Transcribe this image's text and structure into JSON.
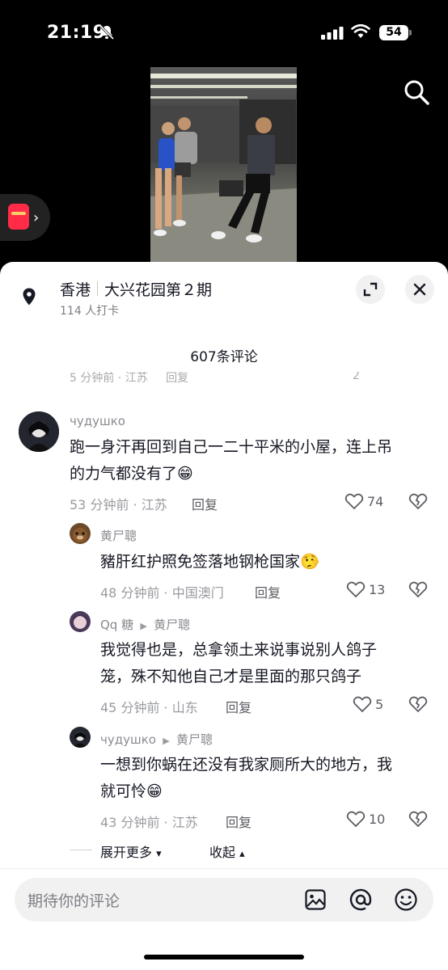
{
  "status_bar": {
    "time": "21:19",
    "battery": "54"
  },
  "location": {
    "city": "香港",
    "place": "大兴花园第２期",
    "checkins": "114 人打卡"
  },
  "comments_count": "607条评论",
  "cut_row": {
    "meta": "5 分钟前 · 江苏",
    "reply": "回复",
    "likes": "2"
  },
  "comments": [
    {
      "user": "чудушко",
      "text_line1": "跑一身汗再回到自己一二十平米的小屋，连上吊",
      "text_line2": "的力气都没有了😁",
      "meta": "53 分钟前 · 江苏",
      "reply": "回复",
      "likes": "74"
    }
  ],
  "replies": [
    {
      "user": "黄尸聰",
      "text_line1": "豬肝红护照免签落地钢枪国家🤥",
      "meta": "48 分钟前 · 中国澳门",
      "reply": "回复",
      "likes": "13"
    },
    {
      "user": "Qq 糖",
      "reply_to": "黄尸聰",
      "text_line1": "我觉得也是，总拿领土来说事说别人鸽子",
      "text_line2": "笼，殊不知他自己才是里面的那只鸽子",
      "meta": "45 分钟前 · 山东",
      "reply": "回复",
      "likes": "5"
    },
    {
      "user": "чудушко",
      "reply_to": "黄尸聰",
      "text_line1": "一想到你蜗在还没有我家厕所大的地方，我",
      "text_line2": "就可怜😁",
      "meta": "43 分钟前 · 江苏",
      "reply": "回复",
      "likes": "10"
    }
  ],
  "footer": {
    "expand_more": "展开更多",
    "collapse": "收起"
  },
  "input": {
    "placeholder": "期待你的评论"
  },
  "icons": {
    "search": "search-icon",
    "location": "location-pin-icon",
    "expand": "expand-icon",
    "close": "close-icon",
    "like": "heart-icon",
    "dislike": "broken-heart-icon",
    "image": "image-icon",
    "mention": "at-icon",
    "emoji": "emoji-icon"
  },
  "colors": {
    "accent_red": "#ff2b47",
    "text": "#161823",
    "muted": "#9a9ba0"
  }
}
